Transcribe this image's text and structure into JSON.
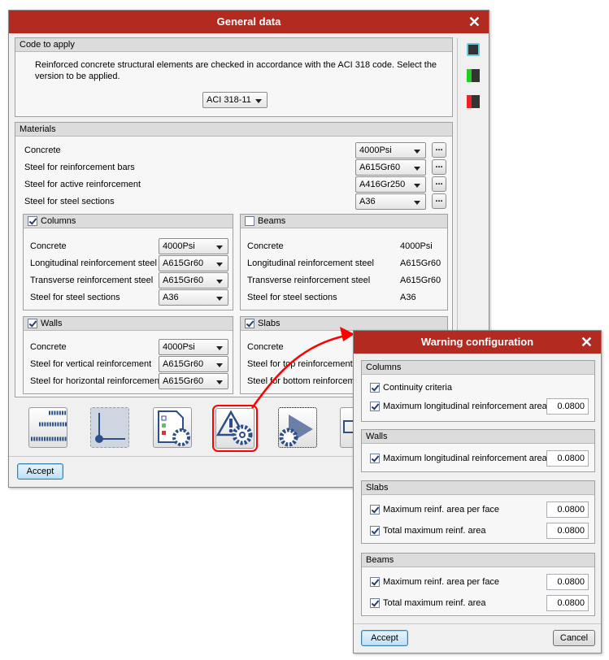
{
  "main": {
    "title": "General data",
    "close": "✕",
    "code": {
      "header": "Code to apply",
      "text1": "Reinforced concrete structural elements are checked in accordance with the ACI 318 code. Select the",
      "text2": "version to be applied.",
      "version": "ACI 318-11"
    },
    "materials": {
      "header": "Materials",
      "rows": [
        {
          "label": "Concrete",
          "value": "4000Psi"
        },
        {
          "label": "Steel for reinforcement bars",
          "value": "A615Gr60"
        },
        {
          "label": "Steel for active reinforcement",
          "value": "A416Gr250"
        },
        {
          "label": "Steel for steel sections",
          "value": "A36"
        }
      ],
      "dots": "..."
    },
    "columns": {
      "header": "Columns",
      "rows": [
        {
          "label": "Concrete",
          "value": "4000Psi"
        },
        {
          "label": "Longitudinal reinforcement steel",
          "value": "A615Gr60"
        },
        {
          "label": "Transverse reinforcement steel",
          "value": "A615Gr60"
        },
        {
          "label": "Steel for steel sections",
          "value": "A36"
        }
      ]
    },
    "beams": {
      "header": "Beams",
      "rows": [
        {
          "label": "Concrete",
          "value": "4000Psi"
        },
        {
          "label": "Longitudinal reinforcement steel",
          "value": "A615Gr60"
        },
        {
          "label": "Transverse reinforcement steel",
          "value": "A615Gr60"
        },
        {
          "label": "Steel for steel sections",
          "value": "A36"
        }
      ]
    },
    "walls": {
      "header": "Walls",
      "rows": [
        {
          "label": "Concrete",
          "value": "4000Psi"
        },
        {
          "label": "Steel for vertical reinforcement",
          "value": "A615Gr60"
        },
        {
          "label": "Steel for horizontal reinforcement",
          "value": "A615Gr60"
        }
      ]
    },
    "slabs": {
      "header": "Slabs",
      "rows": [
        {
          "label": "Concrete"
        },
        {
          "label": "Steel for top reinforcement"
        },
        {
          "label": "Steel for bottom reinforceme"
        }
      ]
    },
    "accept": "Accept"
  },
  "warning": {
    "title": "Warning configuration",
    "close": "✕",
    "columns": {
      "header": "Columns",
      "items": [
        {
          "label": "Continuity criteria"
        },
        {
          "label": "Maximum longitudinal reinforcement area",
          "value": "0.0800"
        }
      ]
    },
    "walls": {
      "header": "Walls",
      "items": [
        {
          "label": "Maximum longitudinal reinforcement area",
          "value": "0.0800"
        }
      ]
    },
    "slabs": {
      "header": "Slabs",
      "items": [
        {
          "label": "Maximum reinf. area per face",
          "value": "0.0800"
        },
        {
          "label": "Total maximum reinf. area",
          "value": "0.0800"
        }
      ]
    },
    "beams": {
      "header": "Beams",
      "items": [
        {
          "label": "Maximum reinf. area per face",
          "value": "0.0800"
        },
        {
          "label": "Total maximum reinf. area",
          "value": "0.0800"
        }
      ]
    },
    "accept": "Accept",
    "cancel": "Cancel"
  },
  "colors": {
    "titlebar": "#b22a20",
    "highlight": "#ff0000",
    "icon": "#2c4f8a"
  }
}
